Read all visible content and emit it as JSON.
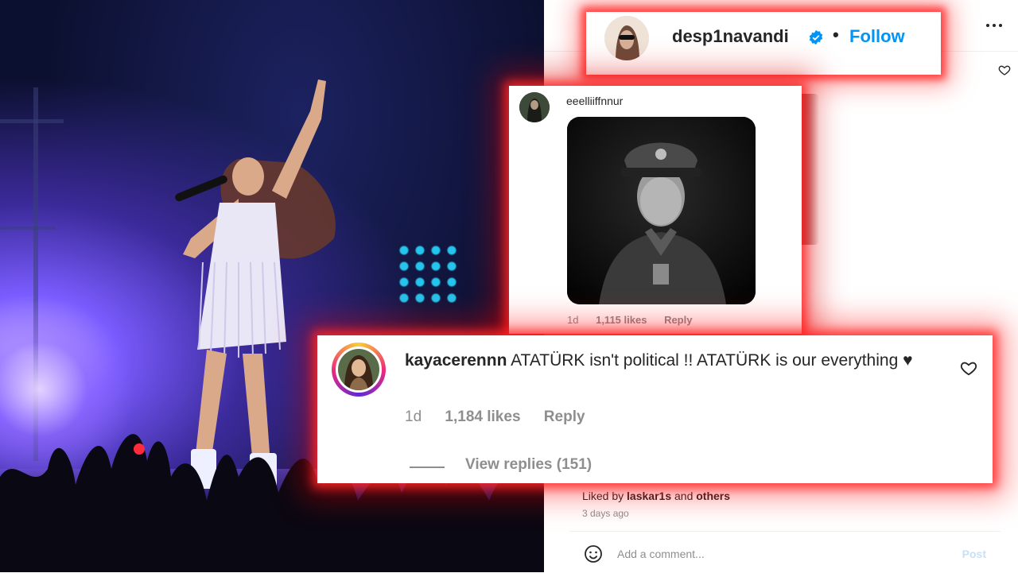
{
  "post_header": {
    "username": "desp1navandi",
    "separator": "•",
    "follow_label": "Follow"
  },
  "photo_comment": {
    "username": "eeelliiffnnur",
    "time": "1d",
    "likes": "1,115 likes",
    "reply_label": "Reply"
  },
  "highlight_comment": {
    "username": "kayacerennn",
    "text": "ATATÜRK isn't political !! ATATÜRK is our everything ♥",
    "time": "1d",
    "likes": "1,184 likes",
    "reply_label": "Reply",
    "view_replies": "View replies (151)"
  },
  "post_footer": {
    "liked_prefix": "Liked by",
    "liked_user": "laskar1s",
    "liked_and": "and",
    "liked_others": "others",
    "timestamp": "3 days ago",
    "comment_placeholder": "Add a comment...",
    "post_label": "Post"
  },
  "colors": {
    "accent": "#0095f6",
    "highlight_glow": "#ff2828",
    "verified": "#0095f6"
  },
  "icons": [
    "more-icon",
    "heart-icon",
    "verified-icon",
    "smile-icon"
  ]
}
